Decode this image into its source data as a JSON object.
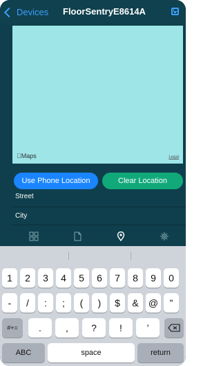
{
  "nav": {
    "back_label": "Devices",
    "title": "FloorSentryE8614A"
  },
  "map": {
    "logo_text": "Maps",
    "legal_text": "Legal"
  },
  "location_buttons": {
    "use_phone": "Use Phone Location",
    "clear": "Clear Location"
  },
  "fields": {
    "street_label": "Street",
    "city_label": "City"
  },
  "tabs": [
    {
      "icon": "grid-icon"
    },
    {
      "icon": "document-icon"
    },
    {
      "icon": "location-pin-icon",
      "selected": true
    },
    {
      "icon": "gear-icon"
    }
  ],
  "keyboard": {
    "row1": [
      "1",
      "2",
      "3",
      "4",
      "5",
      "6",
      "7",
      "8",
      "9",
      "0"
    ],
    "row2": [
      "-",
      "/",
      ":",
      ";",
      "(",
      ")",
      "$",
      "&",
      "@",
      "”"
    ],
    "row3_left": "#+=",
    "row3": [
      ".",
      ",",
      "?",
      "!",
      "’"
    ],
    "row4": {
      "abc": "ABC",
      "space": "space",
      "return": "return"
    }
  },
  "colors": {
    "accent": "#1a85ff",
    "green": "#11a97a",
    "background": "#0f3f4c",
    "map": "#9ee5e8"
  }
}
